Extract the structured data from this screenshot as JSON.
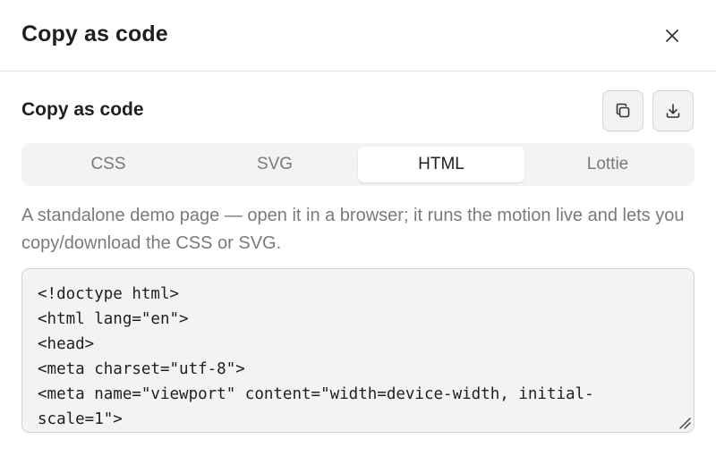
{
  "dialog": {
    "title": "Copy as code",
    "close_icon": "close-icon"
  },
  "section": {
    "title": "Copy as code",
    "copy_icon": "copy-icon",
    "download_icon": "download-icon"
  },
  "tabs": [
    {
      "label": "CSS",
      "active": false
    },
    {
      "label": "SVG",
      "active": false
    },
    {
      "label": "HTML",
      "active": true
    },
    {
      "label": "Lottie",
      "active": false
    }
  ],
  "description": "A standalone demo page — open it in a browser; it runs the motion live and lets you copy/download the CSS or SVG.",
  "code": {
    "lines": [
      "<!doctype html>",
      "<html lang=\"en\">",
      "<head>",
      "<meta charset=\"utf-8\">",
      "<meta name=\"viewport\" content=\"width=device-width, initial-",
      "scale=1\">"
    ]
  },
  "colors": {
    "text": "#1f1f1f",
    "muted": "#7a7a7a",
    "surface": "#f3f3f3",
    "border": "#d4d4d4"
  }
}
